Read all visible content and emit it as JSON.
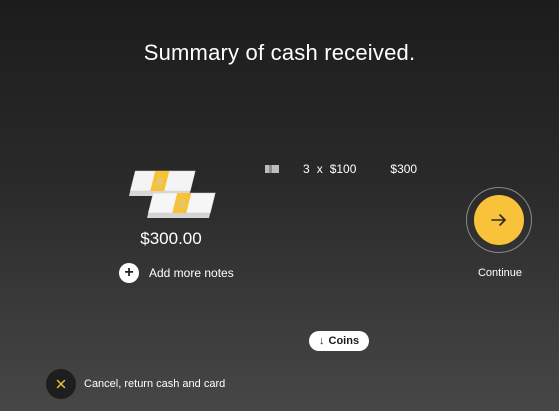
{
  "header": {
    "title": "Summary of cash received."
  },
  "cash": {
    "total": "$300.00",
    "add_more_label": "Add more notes",
    "add_icon": "plus-icon",
    "illustration_icon": "cash-stack-icon"
  },
  "notes": [
    {
      "icon": "banknote-icon",
      "count": "3",
      "times": "x",
      "denomination": "$100",
      "subtotal": "$300"
    }
  ],
  "continue": {
    "label": "Continue",
    "icon": "arrow-right-icon"
  },
  "coins": {
    "arrow": "↓",
    "label": "Coins"
  },
  "cancel": {
    "label": "Cancel, return cash and card",
    "icon": "close-icon"
  },
  "colors": {
    "accent": "#f8c33a",
    "text": "#ffffff",
    "background_top": "#1c1c1c",
    "background_bottom": "#474747"
  }
}
